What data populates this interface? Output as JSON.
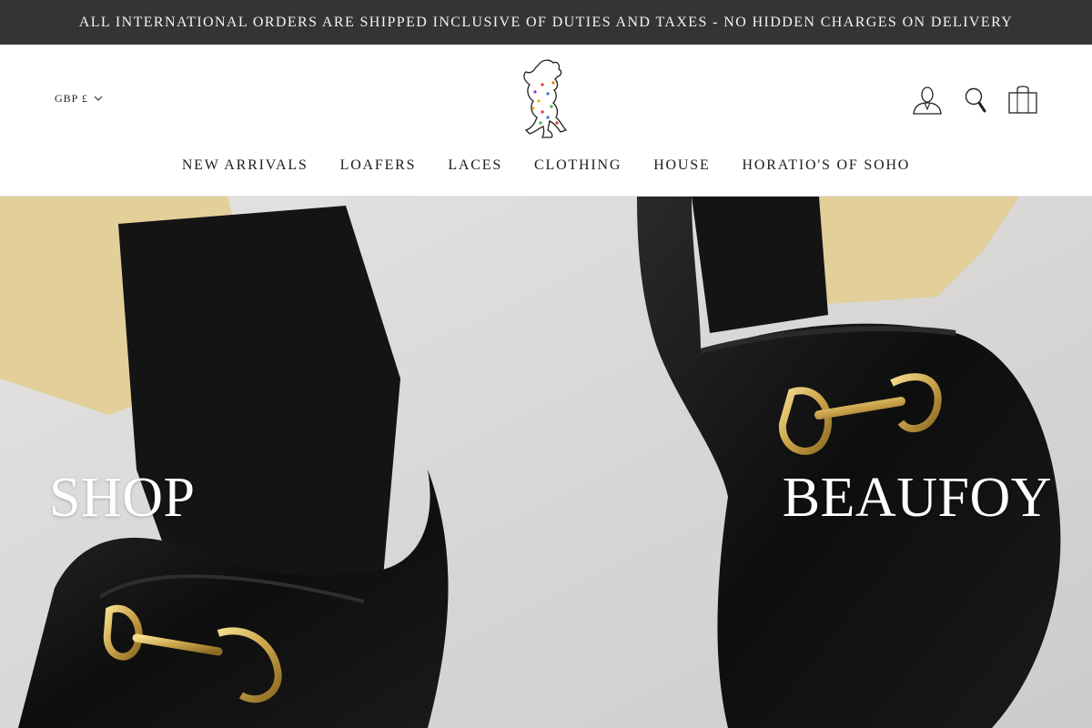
{
  "announcement": {
    "text": "ALL INTERNATIONAL ORDERS ARE SHIPPED INCLUSIVE OF DUTIES AND TAXES - NO HIDDEN CHARGES ON DELIVERY"
  },
  "header": {
    "currency_label": "GBP £",
    "icons": {
      "logo": "rampant-lion-logo",
      "account": "account-icon",
      "search": "search-icon",
      "cart": "shopping-bag-icon",
      "currency_chevron": "chevron-down-icon"
    }
  },
  "nav": {
    "items": [
      {
        "label": "NEW ARRIVALS"
      },
      {
        "label": "LOAFERS"
      },
      {
        "label": "LACES"
      },
      {
        "label": "CLOTHING"
      },
      {
        "label": "HOUSE"
      },
      {
        "label": "HORATIO'S OF SOHO"
      }
    ]
  },
  "hero": {
    "title_left": "SHOP",
    "title_right": "BEAUFOY"
  },
  "colors": {
    "announcement_bg": "#343434",
    "hero_floor": "#d9d8d6",
    "trouser": "#e2cf9a",
    "shoe": "#101010",
    "buckle": "#c9a24a"
  }
}
